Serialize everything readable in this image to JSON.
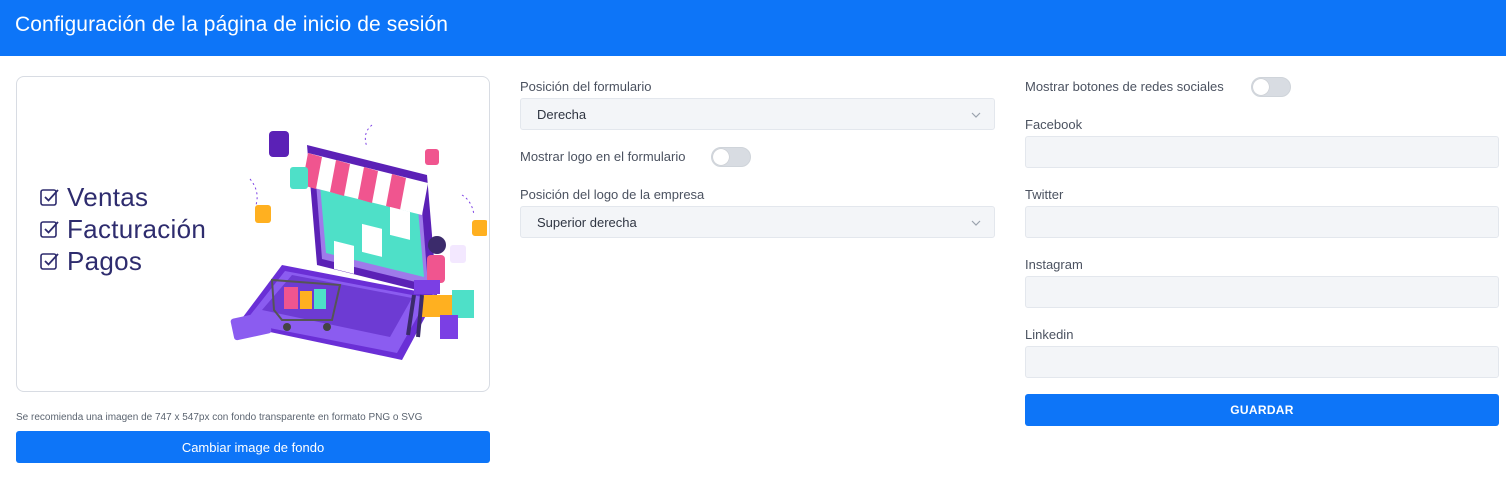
{
  "header": {
    "title": "Configuración de la página de inicio de sesión"
  },
  "preview": {
    "checklist": [
      "Ventas",
      "Facturación",
      "Pagos"
    ],
    "recommendation": "Se recomienda una imagen de 747 x 547px con fondo transparente en formato PNG o SVG",
    "change_button": "Cambiar image de fondo"
  },
  "form": {
    "form_position": {
      "label": "Posición del formulario",
      "value": "Derecha"
    },
    "show_logo": {
      "label": "Mostrar logo en el formulario",
      "enabled": false
    },
    "logo_position": {
      "label": "Posición del logo de la empresa",
      "value": "Superior derecha"
    }
  },
  "social": {
    "show_buttons": {
      "label": "Mostrar botones de redes sociales",
      "enabled": false
    },
    "fields": [
      {
        "label": "Facebook",
        "value": ""
      },
      {
        "label": "Twitter",
        "value": ""
      },
      {
        "label": "Instagram",
        "value": ""
      },
      {
        "label": "Linkedin",
        "value": ""
      }
    ],
    "save_button": "GUARDAR"
  },
  "colors": {
    "primary": "#0d75f8",
    "checklist_text": "#2e2c6e",
    "illustration_purple": "#7b3fe4",
    "illustration_pink": "#f0558f"
  }
}
